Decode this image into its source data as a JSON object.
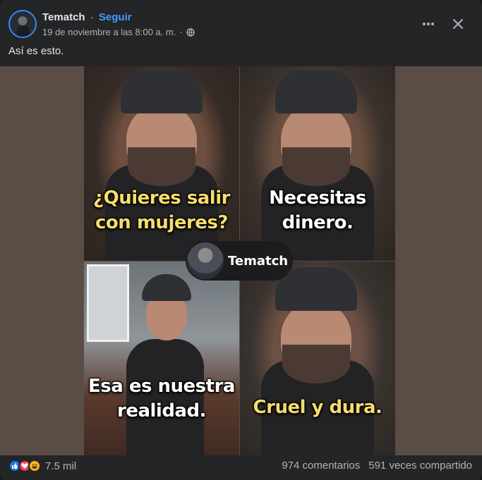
{
  "post": {
    "author": "Tematch",
    "separator": "·",
    "follow_label": "Seguir",
    "timestamp": "19 de noviembre a las 8:00 a. m.",
    "meta_separator": "·",
    "privacy_icon": "globe-icon",
    "caption": "Así es esto."
  },
  "media": {
    "panels": [
      {
        "lines": [
          "¿Quieres salir",
          "con mujeres?"
        ],
        "color": "#f5dc6c"
      },
      {
        "lines": [
          "Necesitas",
          "dinero."
        ],
        "color": "#ffffff"
      },
      {
        "lines": [
          "Esa es nuestra",
          "realidad."
        ],
        "color": "#ffffff"
      },
      {
        "lines": [
          "Cruel y dura."
        ],
        "color": "#f5dc6c"
      }
    ],
    "watermark": "Tematch"
  },
  "footer": {
    "reactions": [
      "like",
      "love",
      "haha"
    ],
    "reaction_count": "7.5 mil",
    "comments": "974 comentarios",
    "shares": "591 veces compartido"
  },
  "colors": {
    "link": "#4599ff",
    "background": "#242526",
    "text_secondary": "#b0b3b8"
  }
}
